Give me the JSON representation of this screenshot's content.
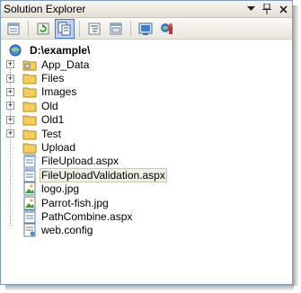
{
  "panel": {
    "title": "Solution Explorer",
    "title_buttons": [
      "chevron-down-icon",
      "pin-icon",
      "close-icon"
    ]
  },
  "toolbar": {
    "tools": [
      "properties-icon",
      "refresh-icon",
      "show-all-files-icon",
      "view-code-icon",
      "view-designer-icon",
      "copy-website-icon",
      "asp-net-config-icon"
    ],
    "active_tool": "show-all-files-icon"
  },
  "tree": {
    "root": {
      "label": "D:\\example\\"
    },
    "items": [
      {
        "label": "App_Data",
        "type": "folder",
        "expandable": true
      },
      {
        "label": "Files",
        "type": "folder",
        "expandable": true
      },
      {
        "label": "Images",
        "type": "folder",
        "expandable": true
      },
      {
        "label": "Old",
        "type": "folder",
        "expandable": true
      },
      {
        "label": "Old1",
        "type": "folder",
        "expandable": true
      },
      {
        "label": "Test",
        "type": "folder",
        "expandable": true
      },
      {
        "label": "Upload",
        "type": "folder",
        "expandable": false
      },
      {
        "label": "FileUpload.aspx",
        "type": "aspx",
        "expandable": false
      },
      {
        "label": "FileUploadValidation.aspx",
        "type": "aspx",
        "expandable": false,
        "selected": true
      },
      {
        "label": "logo.jpg",
        "type": "image",
        "expandable": false
      },
      {
        "label": "Parrot-fish.jpg",
        "type": "image",
        "expandable": false
      },
      {
        "label": "PathCombine.aspx",
        "type": "aspx",
        "expandable": false
      },
      {
        "label": "web.config",
        "type": "config",
        "expandable": false
      }
    ]
  },
  "colors": {
    "frame_border": "#7f9db9",
    "folder": "#f5cf5a",
    "selection_bg": "#f0efe6",
    "toolbar_active": "#c1d2ee"
  }
}
